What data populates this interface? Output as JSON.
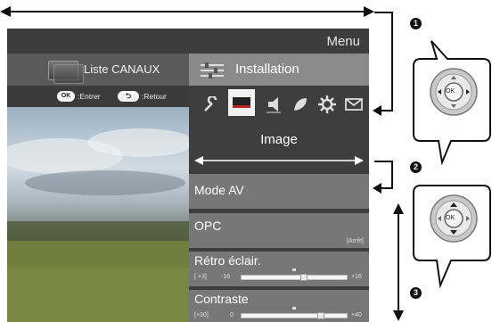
{
  "menu": {
    "title": "Menu"
  },
  "left_panel": {
    "channels_label": "Liste CANAUX",
    "hints": {
      "ok_pill": "OK",
      "ok_text": ":Entrer",
      "back_pill": "⮌",
      "back_text": ":Retour"
    }
  },
  "right_panel": {
    "header_label": "Installation",
    "icons": [
      "wrench-icon",
      "picture-icon",
      "speaker-icon",
      "leaf-icon",
      "gear-icon",
      "envelope-icon"
    ],
    "section_label": "Image",
    "items": [
      {
        "title": "Mode AV"
      },
      {
        "title": "OPC",
        "value": "[Arrêt]"
      },
      {
        "title": "Rétro éclair.",
        "current": "[ +3]",
        "min": "-16",
        "max": "+16",
        "level": 0.59
      },
      {
        "title": "Contraste",
        "current": "[+30]",
        "min": "0",
        "max": "+40",
        "level": 0.75
      }
    ]
  },
  "annotations": {
    "callout_1": "1",
    "callout_2": "2",
    "callout_3": "3",
    "ok_label": "OK"
  },
  "colors": {
    "selected_header": "#8a8a8a",
    "item_bg": "#777777",
    "panel_bg": "#3e3e3e"
  }
}
